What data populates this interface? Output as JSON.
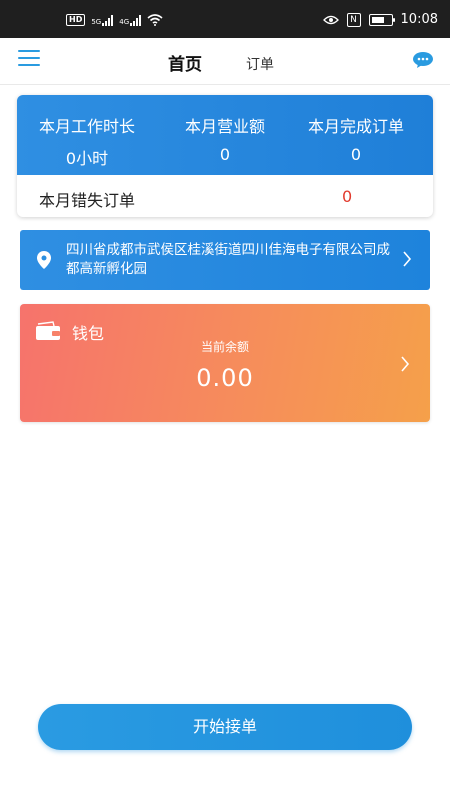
{
  "status_bar": {
    "hd_label": "HD",
    "net1": "5G",
    "net2": "4G",
    "time": "10:08",
    "nfc_label": "N",
    "icons": [
      "hd-badge-icon",
      "signal-5g-icon",
      "signal-4g-icon",
      "wifi-icon",
      "eye-icon",
      "nfc-icon",
      "battery-icon"
    ],
    "battery_level": 0.65
  },
  "nav": {
    "tab_home": "首页",
    "tab_orders": "订单",
    "menu_icon": "hamburger-menu-icon",
    "chat_icon": "chat-bubble-icon"
  },
  "stats": {
    "hours_label": "本月工作时长",
    "hours_value": "0小时",
    "revenue_label": "本月营业额",
    "revenue_value": "0",
    "completed_label": "本月完成订单",
    "completed_value": "0",
    "missed_label": "本月错失订单",
    "missed_value": "0"
  },
  "location": {
    "address": "四川省成都市武侯区桂溪街道四川佳海电子有限公司成都高新孵化园",
    "pin_icon": "location-pin-icon",
    "arrow_icon": "chevron-right-icon"
  },
  "wallet": {
    "title": "钱包",
    "balance_label": "当前余额",
    "balance_value": "0.00",
    "wallet_icon": "wallet-icon",
    "arrow_icon": "chevron-right-icon"
  },
  "action": {
    "start_label": "开始接单"
  },
  "colors": {
    "accent_blue": "#2a8fe0",
    "wallet_start": "#f6736c",
    "wallet_end": "#f5a04a",
    "missed_red": "#e23b2e"
  }
}
